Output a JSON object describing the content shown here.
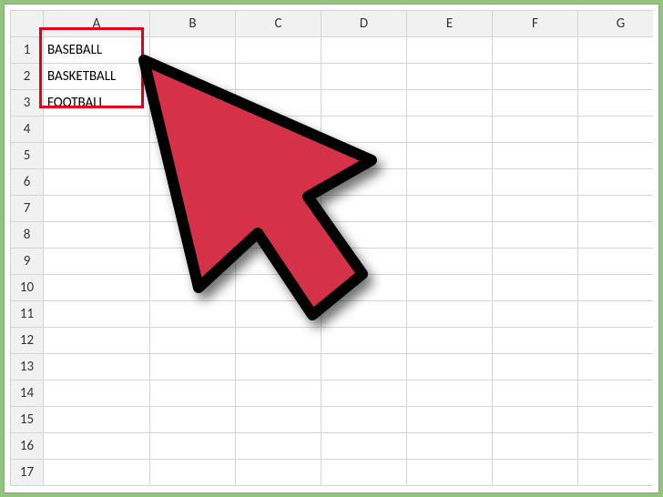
{
  "columns": [
    "A",
    "B",
    "C",
    "D",
    "E",
    "F",
    "G"
  ],
  "rows": [
    "1",
    "2",
    "3",
    "4",
    "5",
    "6",
    "7",
    "8",
    "9",
    "10",
    "11",
    "12",
    "13",
    "14",
    "15",
    "16",
    "17"
  ],
  "cells": {
    "A1": "BASEBALL",
    "A2": "BASKETBALL",
    "A3": "FOOTBALL"
  },
  "highlight": {
    "range": "A1:A3"
  },
  "cursor": {
    "color_fill": "#d53348",
    "color_outline": "#000000"
  }
}
